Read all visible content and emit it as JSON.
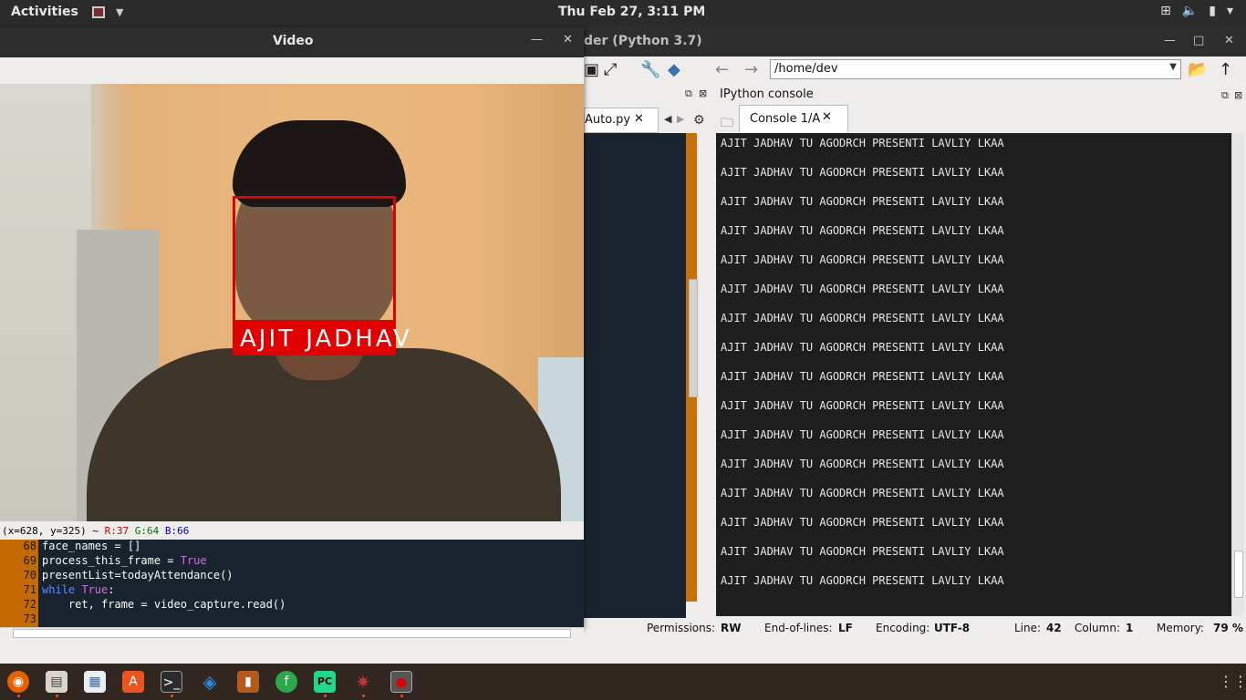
{
  "topbar": {
    "activities": "Activities",
    "clock": "Thu Feb 27,  3:11 PM",
    "tray_icons": [
      "network-icon",
      "volume-icon",
      "battery-icon",
      "power-menu-icon"
    ]
  },
  "spyder": {
    "title": "der (Python 3.7)",
    "path": "/home/dev",
    "editor_tab": "Auto.py",
    "console_header": "IPython console",
    "console_tab": "Console 1/A",
    "console_lines": [
      "AJIT JADHAV TU AGODRCH PRESENTI LAVLIY LKAA",
      "AJIT JADHAV TU AGODRCH PRESENTI LAVLIY LKAA",
      "AJIT JADHAV TU AGODRCH PRESENTI LAVLIY LKAA",
      "AJIT JADHAV TU AGODRCH PRESENTI LAVLIY LKAA",
      "AJIT JADHAV TU AGODRCH PRESENTI LAVLIY LKAA",
      "AJIT JADHAV TU AGODRCH PRESENTI LAVLIY LKAA",
      "AJIT JADHAV TU AGODRCH PRESENTI LAVLIY LKAA",
      "AJIT JADHAV TU AGODRCH PRESENTI LAVLIY LKAA",
      "AJIT JADHAV TU AGODRCH PRESENTI LAVLIY LKAA",
      "AJIT JADHAV TU AGODRCH PRESENTI LAVLIY LKAA",
      "AJIT JADHAV TU AGODRCH PRESENTI LAVLIY LKAA",
      "AJIT JADHAV TU AGODRCH PRESENTI LAVLIY LKAA",
      "AJIT JADHAV TU AGODRCH PRESENTI LAVLIY LKAA",
      "AJIT JADHAV TU AGODRCH PRESENTI LAVLIY LKAA",
      "AJIT JADHAV TU AGODRCH PRESENTI LAVLIY LKAA",
      "AJIT JADHAV TU AGODRCH PRESENTI LAVLIY LKAA"
    ],
    "status": {
      "permissions_label": "Permissions:",
      "permissions_value": "RW",
      "eol_label": "End-of-lines:",
      "eol_value": "LF",
      "encoding_label": "Encoding:",
      "encoding_value": "UTF-8",
      "line_label": "Line:",
      "line_value": "42",
      "column_label": "Column:",
      "column_value": "1",
      "memory_label": "Memory:",
      "memory_value": "79 %"
    }
  },
  "video": {
    "title": "Video",
    "face_label": "AJIT JADHAV",
    "pixel_info": {
      "coords": "(x=628, y=325) ~",
      "r": "R:37",
      "g": "G:64",
      "b": "B:66"
    }
  },
  "code": [
    {
      "ln": "68",
      "text": "face_names = []"
    },
    {
      "ln": "69",
      "text": "process_this_frame = ",
      "kw": "True"
    },
    {
      "ln": "70",
      "text": "presentList=todayAttendance()"
    },
    {
      "ln": "71",
      "kw_lead": "while ",
      "kw": "True",
      "text": ":"
    },
    {
      "ln": "72",
      "text": "    ret, frame = video_capture.read()"
    },
    {
      "ln": "73",
      "text": ""
    }
  ],
  "dock": {
    "apps": [
      "firefox-icon",
      "files-cabinet-icon",
      "document-viewer-icon",
      "software-store-icon",
      "terminal-icon",
      "vscode-icon",
      "archive-manager-icon",
      "feedreader-icon",
      "pycharm-icon",
      "spyder-icon",
      "opencv-window-icon"
    ]
  }
}
